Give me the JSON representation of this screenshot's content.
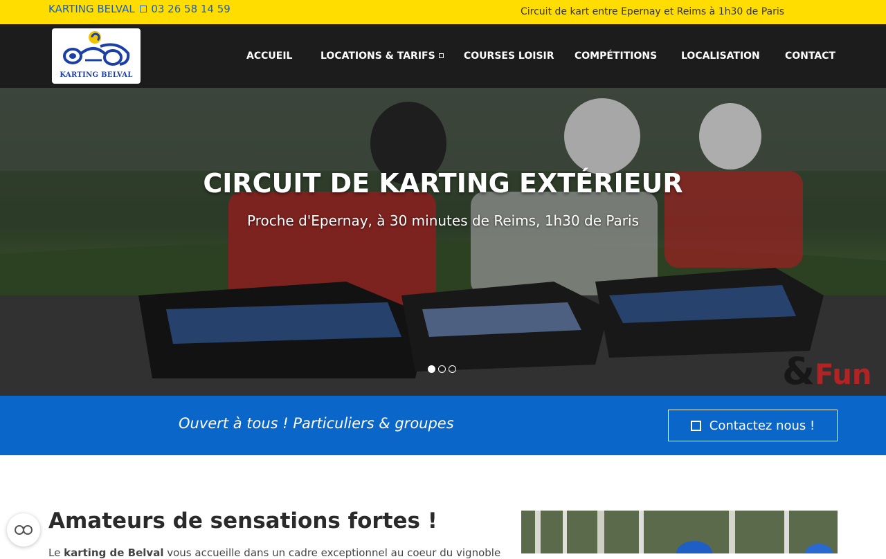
{
  "topbar": {
    "brand": "KARTING BELVAL",
    "phone": "03 26 58 14 59",
    "tagline": "Circuit de kart entre Epernay et Reims à 1h30 de Paris"
  },
  "logo": {
    "text": "KARTING BELVAL"
  },
  "nav": {
    "items": [
      {
        "label": "ACCUEIL"
      },
      {
        "label": "LOCATIONS & TARIFS"
      },
      {
        "label": "COURSES LOISIR"
      },
      {
        "label": "COMPÉTITIONS"
      },
      {
        "label": "LOCALISATION"
      },
      {
        "label": "CONTACT"
      }
    ]
  },
  "hero": {
    "title": "CIRCUIT DE KARTING EXTÉRIEUR",
    "subtitle": "Proche d'Epernay, à 30 minutes de Reims, 1h30 de Paris",
    "watermark_amp": "&",
    "watermark_word": "Fun",
    "slides_total": 3,
    "slide_active": 1
  },
  "band": {
    "message": "Ouvert à tous ! Particuliers & groupes",
    "button_label": "Contactez nous !",
    "color": "#0a66c9"
  },
  "content": {
    "title": "Amateurs de sensations fortes !",
    "text_prefix": "Le ",
    "text_bold": "karting de Belval",
    "text_rest": " vous accueille dans un cadre exceptionnel au coeur du vignoble"
  },
  "colors": {
    "topbar": "#ffdd00",
    "navbar": "#1c1c1c",
    "accent": "#0a66c9"
  },
  "icons": {
    "cookie": "cookie-settings-icon",
    "dropdown": "square-icon",
    "contact": "square-icon"
  }
}
